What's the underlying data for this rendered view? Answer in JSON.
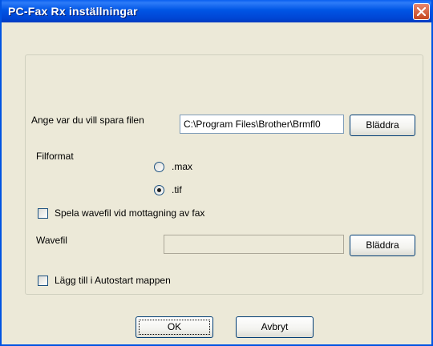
{
  "window": {
    "title": "PC-Fax Rx inställningar"
  },
  "save_location": {
    "label": "Ange var du vill spara filen",
    "path": "C:\\Program Files\\Brother\\Brmfl0",
    "browse_label": "Bläddra"
  },
  "file_format": {
    "label": "Filformat",
    "options": [
      {
        "label": ".max",
        "selected": false
      },
      {
        "label": ".tif",
        "selected": true
      }
    ]
  },
  "play_wave": {
    "label": "Spela wavefil vid mottagning av fax",
    "checked": false
  },
  "wave_file": {
    "label": "Wavefil",
    "value": "",
    "browse_label": "Bläddra"
  },
  "autostart": {
    "label": "Lägg till i Autostart mappen",
    "checked": false
  },
  "buttons": {
    "ok": "OK",
    "cancel": "Avbryt"
  }
}
